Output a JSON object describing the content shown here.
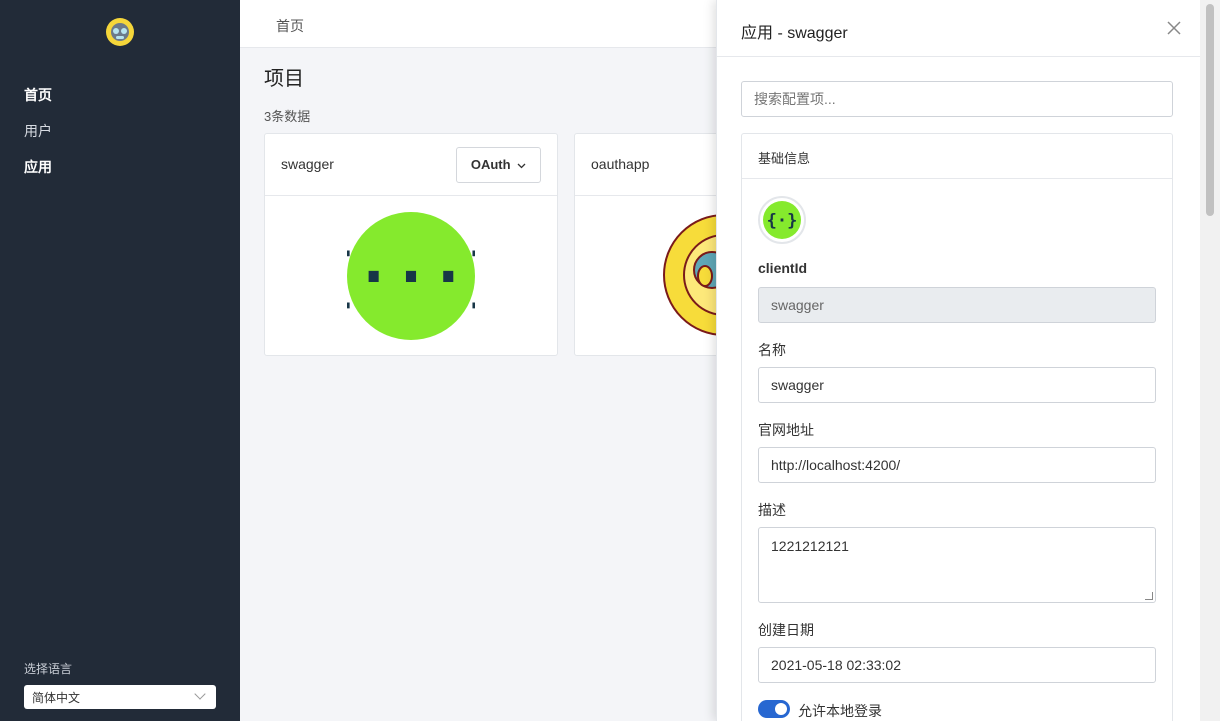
{
  "sidebar": {
    "nav": [
      {
        "label": "首页"
      },
      {
        "label": "用户"
      },
      {
        "label": "应用"
      }
    ],
    "language_label": "选择语言",
    "language_value": "简体中文"
  },
  "header": {
    "breadcrumb": "首页"
  },
  "main": {
    "title": "项目",
    "count": "3条数据",
    "cards": [
      {
        "name": "swagger",
        "button": "OAuth"
      },
      {
        "name": "oauthapp"
      }
    ]
  },
  "drawer": {
    "title": "应用 - swagger",
    "search_placeholder": "搜索配置项...",
    "section_title": "基础信息",
    "fields": {
      "client_id_label": "clientId",
      "client_id_value": "swagger",
      "name_label": "名称",
      "name_value": "swagger",
      "website_label": "官网地址",
      "website_value": "http://localhost:4200/",
      "desc_label": "描述",
      "desc_value": "1221212121",
      "created_label": "创建日期",
      "created_value": "2021-05-18 02:33:02",
      "local_login_label": "允许本地登录"
    },
    "local_login_enabled": true
  },
  "colors": {
    "sidebar_bg": "#222b38",
    "swagger_green": "#85ea2d",
    "toggle_blue": "#2767d1"
  }
}
